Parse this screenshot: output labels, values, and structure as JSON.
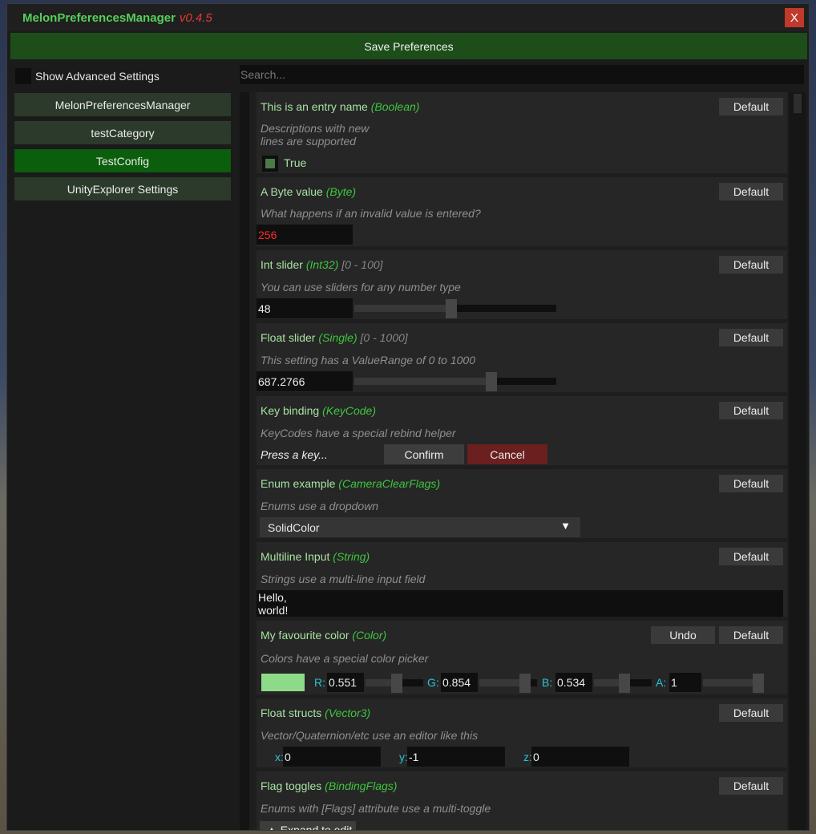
{
  "app": {
    "title": "MelonPreferencesManager",
    "version": "v0.4.5",
    "close_label": "X"
  },
  "save_button": "Save Preferences",
  "show_advanced": "Show Advanced Settings",
  "search_placeholder": "Search...",
  "categories": [
    {
      "label": "MelonPreferencesManager",
      "active": false
    },
    {
      "label": "testCategory",
      "active": false
    },
    {
      "label": "TestConfig",
      "active": true
    },
    {
      "label": "UnityExplorer Settings",
      "active": false
    }
  ],
  "default_label": "Default",
  "entries": {
    "bool": {
      "name": "This is an entry name",
      "type": "Boolean",
      "desc_line1": "Descriptions with new",
      "desc_line2": "lines are supported",
      "value": "True"
    },
    "byte": {
      "name": "A Byte value",
      "type": "Byte",
      "desc": "What happens if an invalid value is entered?",
      "value": "256",
      "value_color": "#ff2a2a"
    },
    "int": {
      "name": "Int slider",
      "type": "Int32",
      "range": "[0 - 100]",
      "desc": "You can use sliders for any number type",
      "value": "48",
      "fraction": 0.48
    },
    "float": {
      "name": "Float slider",
      "type": "Single",
      "range": "[0 - 1000]",
      "desc": "This setting has a ValueRange of 0 to 1000",
      "value": "687.2766",
      "fraction": 0.687
    },
    "key": {
      "name": "Key binding",
      "type": "KeyCode",
      "desc": "KeyCodes have a special rebind helper",
      "prompt": "Press a key...",
      "confirm": "Confirm",
      "cancel": "Cancel"
    },
    "enum": {
      "name": "Enum example",
      "type": "CameraClearFlags",
      "desc": "Enums use a dropdown",
      "value": "SolidColor"
    },
    "multiline": {
      "name": "Multiline Input",
      "type": "String",
      "desc": "Strings use a multi-line input field",
      "line1": "Hello,",
      "line2": "world!"
    },
    "color": {
      "name": "My favourite color",
      "type": "Color",
      "desc": "Colors have a special color picker",
      "undo": "Undo",
      "swatch": "#8ddb88",
      "channels": [
        {
          "label": "R:",
          "value": "0.551",
          "fraction": 0.551
        },
        {
          "label": "G:",
          "value": "0.854",
          "fraction": 0.854
        },
        {
          "label": "B:",
          "value": "0.534",
          "fraction": 0.534
        },
        {
          "label": "A:",
          "value": "1",
          "fraction": 1
        }
      ]
    },
    "vector": {
      "name": "Float structs",
      "type": "Vector3",
      "desc": "Vector/Quaternion/etc use an editor like this",
      "x_label": "x:",
      "x": "0",
      "y_label": "y:",
      "y": "-1",
      "z_label": "z:",
      "z": "0"
    },
    "flags": {
      "name": "Flag toggles",
      "type": "BindingFlags",
      "desc": "Enums with [Flags] attribute use a multi-toggle",
      "expand": "▲ Expand to edit"
    }
  },
  "colors": {
    "accent_green": "#55d05a",
    "type_green": "#3ec63e",
    "label_cyan": "#28c3d6",
    "active_category": "#0b5e0b",
    "cancel_red": "#6b1f1f"
  }
}
